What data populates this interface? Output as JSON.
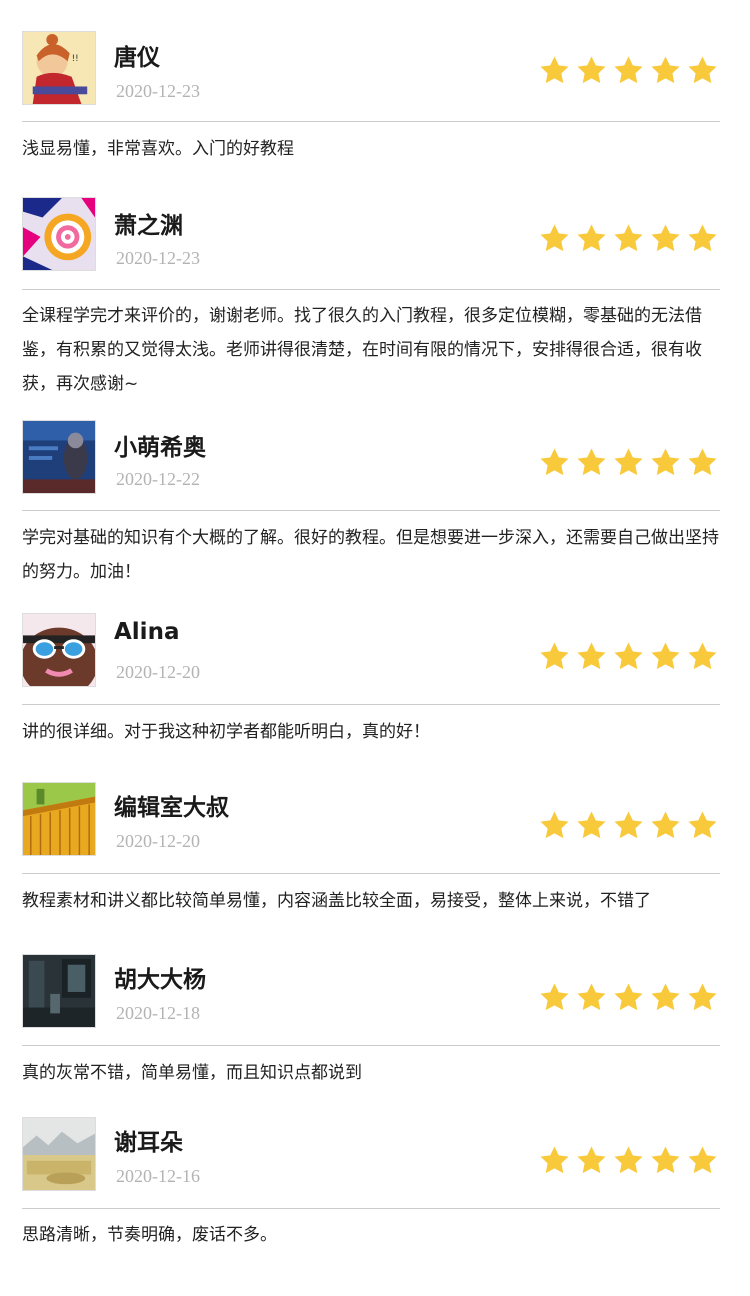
{
  "star_color": "#f8c93a",
  "reviews": [
    {
      "name": "唐仪",
      "date": "2020-12-23",
      "rating": 5,
      "comment": "浅显易懂，非常喜欢。入门的好教程",
      "avatar_icon": "cartoon-girl-avatar"
    },
    {
      "name": "萧之渊",
      "date": "2020-12-23",
      "rating": 5,
      "comment": "全课程学完才来评价的，谢谢老师。找了很久的入门教程，很多定位模糊，零基础的无法借鉴，有积累的又觉得太浅。老师讲得很清楚，在时间有限的情况下，安排得很合适，很有收获，再次感谢~",
      "avatar_icon": "spiral-pattern-avatar"
    },
    {
      "name": "小萌希奥",
      "date": "2020-12-22",
      "rating": 5,
      "comment": "学完对基础的知识有个大概的了解。很好的教程。但是想要进一步深入，还需要自己做出坚持的努力。加油！",
      "avatar_icon": "photo-avatar"
    },
    {
      "name": "Alina",
      "date": "2020-12-20",
      "rating": 5,
      "comment": "讲的很详细。对于我这种初学者都能听明白，真的好！",
      "avatar_icon": "sunglasses-avatar"
    },
    {
      "name": "编辑室大叔",
      "date": "2020-12-20",
      "rating": 5,
      "comment": "教程素材和讲义都比较简单易懂，内容涵盖比较全面，易接受，整体上来说，不错了",
      "avatar_icon": "palace-roof-avatar"
    },
    {
      "name": "胡大大杨",
      "date": "2020-12-18",
      "rating": 5,
      "comment": "真的灰常不错，简单易懂，而且知识点都说到",
      "avatar_icon": "dark-room-avatar"
    },
    {
      "name": "谢耳朵",
      "date": "2020-12-16",
      "rating": 5,
      "comment": "思路清晰，节奏明确，废话不多。",
      "avatar_icon": "landscape-avatar"
    }
  ]
}
